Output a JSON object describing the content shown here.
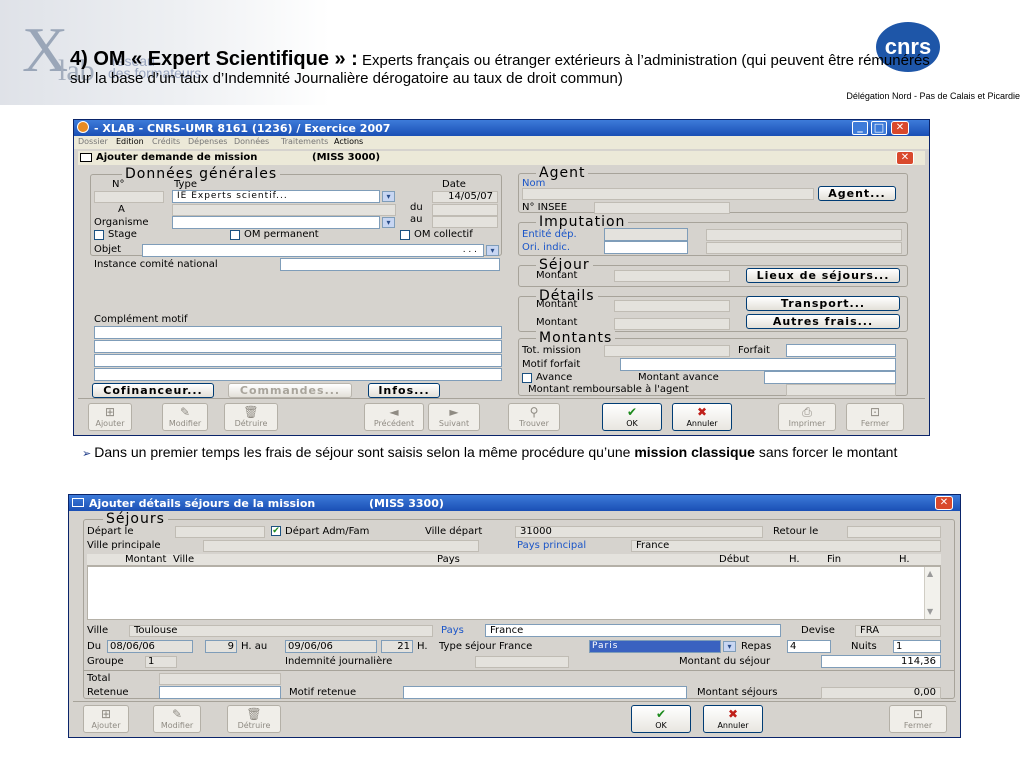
{
  "slide": {
    "logo_x": "X",
    "logo_lab": "lab",
    "logo_reseau": "réseau",
    "logo_formateurs": "des formateurs",
    "cnrs": "cnrs",
    "heading_bold": "4) OM « Expert Scientifique » :",
    "heading_rest": " Experts français ou étranger extérieurs à l’administration (qui peuvent être rémunérés sur la base d’un taux d’Indemnité Journalière dérogatoire au taux de droit commun)",
    "delegation": "Délégation Nord - Pas de Calais et Picardie",
    "bullet_text": "Dans un premier temps les frais de séjour sont saisis selon la même procédure qu’une ",
    "bullet_bold": "mission classique",
    "bullet_end": " sans forcer le montant"
  },
  "win1": {
    "title": "- XLAB - CNRS-UMR 8161 (1236) / Exercice 2007",
    "menu": [
      "Dossier",
      "Edition",
      "Crédits",
      "Dépenses",
      "Données",
      "Traitements",
      "Actions"
    ],
    "subtitle": "Ajouter demande de mission",
    "subcode": "(MISS 3000)",
    "gen_title": "Données générales",
    "no_label": "N°",
    "type_label": "Type",
    "date_label": "Date",
    "type_value": "IE Experts scientif...",
    "date_value": "14/05/07",
    "a_label": "A",
    "du_label": "du",
    "org_label": "Organisme",
    "au_label": "au",
    "stage_label": "Stage",
    "omperm_label": "OM permanent",
    "omcoll_label": "OM collectif",
    "objet_label": "Objet",
    "objet_dots": ". . .",
    "instance_label": "Instance comité national",
    "complement_label": "Complément motif",
    "btn_cofinanceur": "Cofinanceur...",
    "btn_commandes": "Commandes...",
    "btn_infos": "Infos...",
    "agent_title": "Agent",
    "nom_label": "Nom",
    "btn_agent": "Agent...",
    "insee_label": "N° INSEE",
    "imputation_title": "Imputation",
    "entite_label": "Entité dép.",
    "ori_label": "Ori. indic.",
    "sejour_title": "Séjour",
    "montant_label": "Montant",
    "btn_lieux": "Lieux de séjours...",
    "details_title": "Détails",
    "btn_transport": "Transport...",
    "btn_autres": "Autres frais...",
    "montants_title": "Montants",
    "tot_label": "Tot. mission",
    "forfait_label": "Forfait",
    "motif_forfait_label": "Motif forfait",
    "avance_label": "Avance",
    "montant_avance_label": "Montant avance",
    "remboursable_label": "Montant remboursable à l'agent",
    "tb_ajouter": "Ajouter",
    "tb_modifier": "Modifier",
    "tb_detruire": "Détruire",
    "tb_precedent": "Précédent",
    "tb_suivant": "Suivant",
    "tb_trouver": "Trouver",
    "tb_ok": "OK",
    "tb_annuler": "Annuler",
    "tb_imprimer": "Imprimer",
    "tb_fermer": "Fermer"
  },
  "win2": {
    "title": "Ajouter détails séjours de la mission",
    "code": "(MISS 3300)",
    "group_title": "Séjours",
    "depart_label": "Départ le",
    "depart_adm_label": "Départ Adm/Fam",
    "ville_depart_label": "Ville départ",
    "ville_depart_value": "31000",
    "retour_label": "Retour le",
    "ville_principale_label": "Ville principale",
    "pays_principal_label": "Pays principal",
    "pays_principal_value": "France",
    "columns": [
      "Montant",
      "Ville",
      "Pays",
      "Début",
      "H.",
      "Fin",
      "H."
    ],
    "ville_label": "Ville",
    "ville_value": "Toulouse",
    "pays_label": "Pays",
    "pays_value": "France",
    "devise_label": "Devise",
    "devise_value": "FRA",
    "du_label": "Du",
    "du_value": "08/06/06",
    "du_h": "9",
    "h_au_label": "H. au",
    "au_value": "09/06/06",
    "au_h": "21",
    "h_label": "H.",
    "type_sejour_label": "Type séjour France",
    "type_sejour_value": "Paris",
    "repas_label": "Repas",
    "repas_value": "4",
    "nuits_label": "Nuits",
    "nuits_value": "1",
    "groupe_label": "Groupe",
    "groupe_value": "1",
    "indemnite_label": "Indemnité journalière",
    "montant_sejour_label": "Montant du séjour",
    "montant_sejour_value": "114,36",
    "total_label": "Total",
    "retenue_label": "Retenue",
    "motif_retenue_label": "Motif retenue",
    "montant_sejours_label": "Montant séjours",
    "montant_sejours_value": "0,00",
    "tb_ajouter": "Ajouter",
    "tb_modifier": "Modifier",
    "tb_detruire": "Détruire",
    "tb_ok": "OK",
    "tb_annuler": "Annuler",
    "tb_fermer": "Fermer"
  }
}
